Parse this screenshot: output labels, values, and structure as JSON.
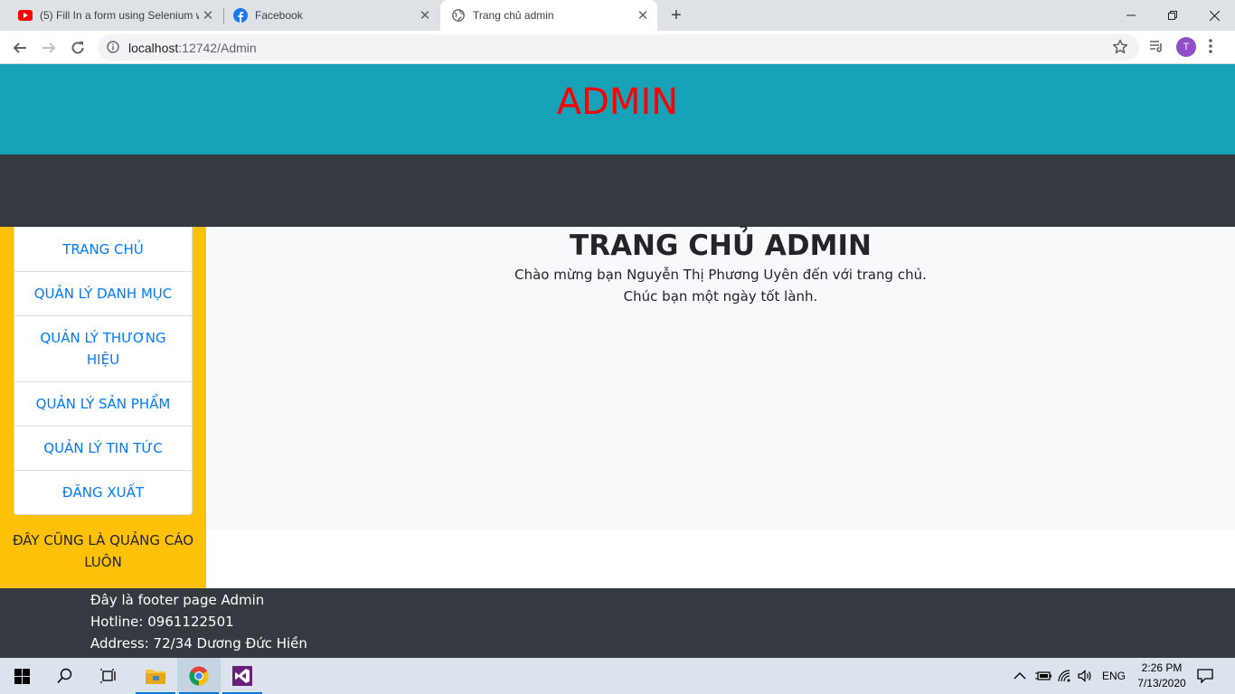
{
  "browser": {
    "tabs": [
      {
        "title": "(5) Fill In a form using Selenium w",
        "icon": "youtube-icon"
      },
      {
        "title": "Facebook",
        "icon": "facebook-icon"
      },
      {
        "title": "Trang chủ admin",
        "icon": "globe-icon"
      }
    ],
    "url_host": "localhost",
    "url_path": ":12742/Admin",
    "profile_initial": "T"
  },
  "page": {
    "header_title": "ADMIN",
    "sidebar": {
      "menu": [
        "TRANG CHỦ",
        "QUẢN LÝ DANH MỤC",
        "QUẢN LÝ THƯƠNG HIỆU",
        "QUẢN LÝ SẢN PHẨM",
        "QUẢN LÝ TIN TỨC",
        "ĐĂNG XUẤT"
      ],
      "ad_text": "ĐÂY CŨNG LÀ QUẢNG CÁO LUÔN"
    },
    "main": {
      "heading": "TRANG CHỦ ADMIN",
      "welcome": "Chào mừng bạn Nguyễn Thị Phương Uyên đến với trang chủ.",
      "wish": "Chúc bạn một ngày tốt lành."
    },
    "footer": {
      "line1": "Đây là footer page Admin",
      "line2": "Hotline: 0961122501",
      "line3": "Address: 72/34 Dương Đức Hiền"
    }
  },
  "taskbar": {
    "language": "ENG",
    "time": "2:26 PM",
    "date": "7/13/2020"
  },
  "colors": {
    "header_bg": "#17a2b8",
    "header_text": "#ff0000",
    "dark_bg": "#343a40",
    "sidebar_bg": "#ffc107",
    "link": "#007bff"
  }
}
